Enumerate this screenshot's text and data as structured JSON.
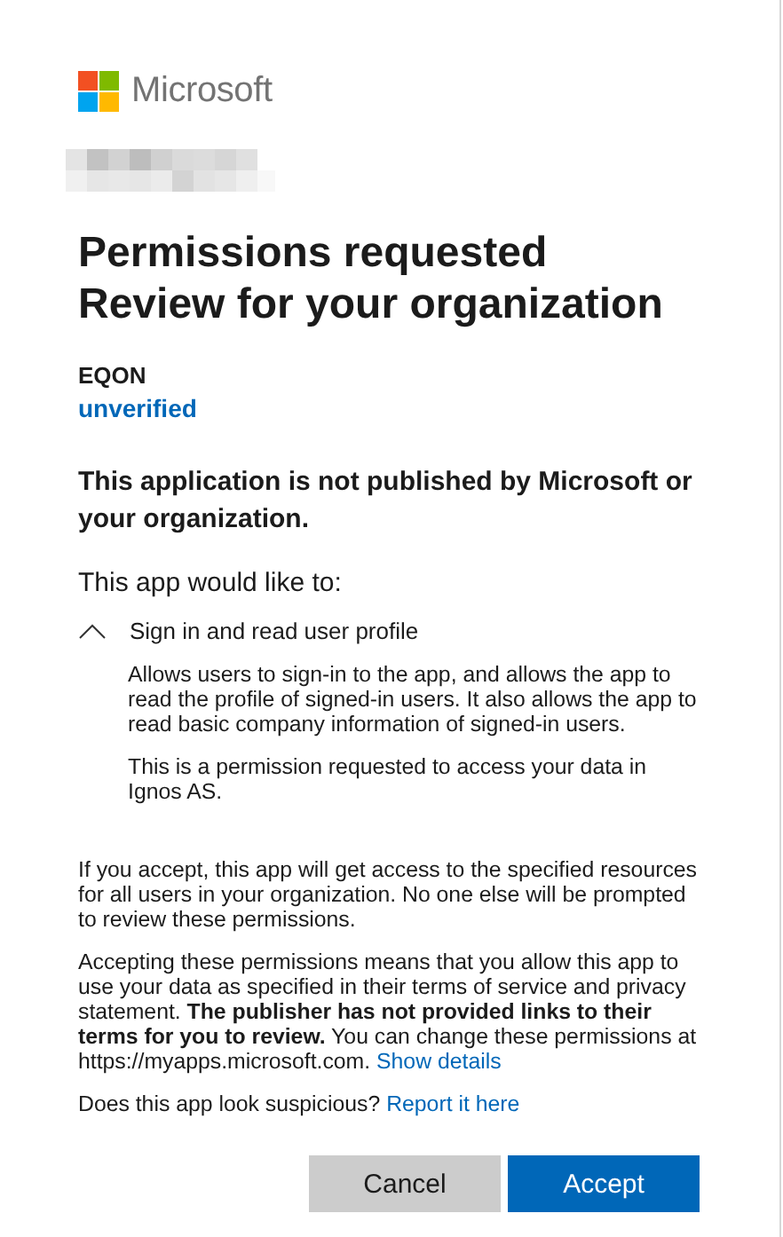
{
  "brand": {
    "name": "Microsoft"
  },
  "title_lines": [
    "Permissions requested",
    "Review for your organization"
  ],
  "app": {
    "name": "EQON",
    "status": "unverified"
  },
  "warning": "This application is not published by Microsoft or your organization.",
  "intro": "This app would like to:",
  "permissions": [
    {
      "label": "Sign in and read user profile",
      "expanded": true,
      "details": [
        "Allows users to sign-in to the app, and allows the app to read the profile of signed-in users. It also allows the app to read basic company information of signed-in users.",
        "This is a permission requested to access your data in Ignos AS."
      ]
    }
  ],
  "consent_text": "If you accept, this app will get access to the specified resources for all users in your organization. No one else will be prompted to review these permissions.",
  "terms": {
    "text": "Accepting these permissions means that you allow this app to use your data as specified in their terms of service and privacy statement. **The publisher has not provided links to their terms for you to review.** You can change these permissions at https://myapps.microsoft.com.",
    "link": "Show details"
  },
  "report": {
    "text": "Does this app look suspicious?",
    "link": "Report it here"
  },
  "buttons": [
    {
      "label": "Cancel",
      "kind": "secondary"
    },
    {
      "label": "Accept",
      "kind": "primary"
    }
  ]
}
